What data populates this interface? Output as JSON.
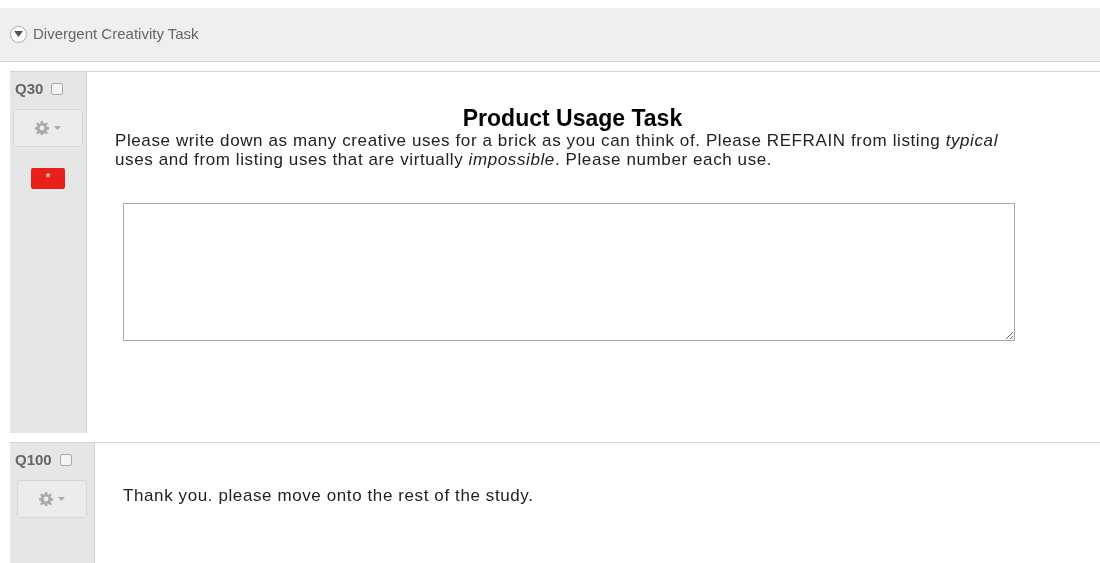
{
  "block": {
    "title": "Divergent Creativity Task",
    "expanded": true
  },
  "questions": [
    {
      "kind": "text_entry",
      "number": "Q30",
      "checked": false,
      "required": true,
      "required_mark": "*",
      "title": "Product Usage Task",
      "text": "Please write down as many creative uses for a brick as you can think of. Please REFRAIN from listing *typical* uses and from listing uses that are virtually *impossible*. Please number each use."
    },
    {
      "kind": "descriptive",
      "number": "Q100",
      "checked": false,
      "required": false,
      "text": "Thank you. please move onto the rest of the study."
    }
  ]
}
